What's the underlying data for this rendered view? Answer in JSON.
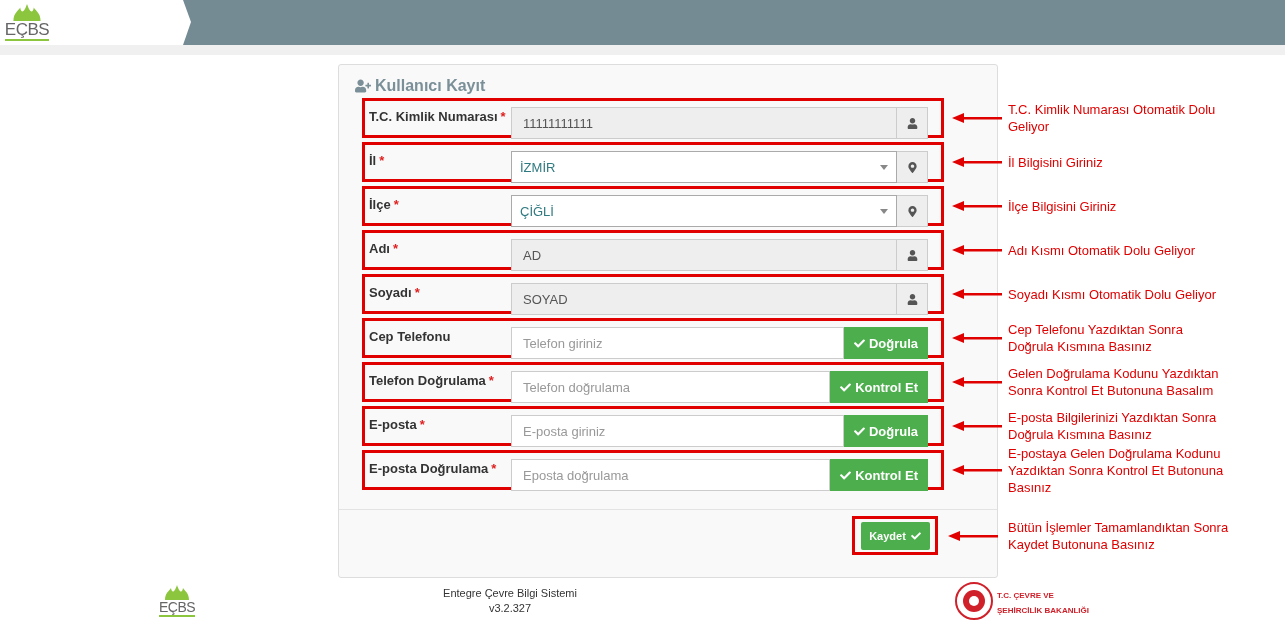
{
  "header": {
    "logo_text": "EÇBS"
  },
  "form": {
    "title": "Kullanıcı Kayıt",
    "fields": [
      {
        "kind": "readonly",
        "label": "T.C. Kimlik Numarası",
        "required_mark": "*",
        "value": "11111111111",
        "highlighted": true,
        "note": "T.C. Kimlik Numarası Otomatik Dolu Geliyor"
      },
      {
        "kind": "select",
        "label": "İl",
        "required_mark": "*",
        "value": "İZMİR",
        "highlighted": true,
        "note": "İl Bilgisini Giriniz"
      },
      {
        "kind": "select",
        "label": "İlçe",
        "required_mark": "*",
        "value": "ÇİĞLİ",
        "highlighted": true,
        "note": "İlçe Bilgisini Giriniz"
      },
      {
        "kind": "readonly",
        "label": "Adı",
        "required_mark": "*",
        "value": "AD",
        "highlighted": true,
        "note": "Adı Kısmı Otomatik Dolu Geliyor"
      },
      {
        "kind": "readonly",
        "label": "Soyadı",
        "required_mark": "*",
        "value": "SOYAD",
        "highlighted": true,
        "note": "Soyadı Kısmı Otomatik Dolu Geliyor"
      },
      {
        "kind": "verify",
        "label": "Cep Telefonu",
        "placeholder": "Telefon giriniz",
        "button": "Doğrula",
        "highlighted": true,
        "note": "Cep Telefonu Yazdıktan Sonra Doğrula Kısmına Basınız"
      },
      {
        "kind": "verify",
        "label": "Telefon Doğrulama",
        "required_mark": "*",
        "placeholder": "Telefon doğrulama",
        "button": "Kontrol Et",
        "highlighted": true,
        "note": "Gelen Doğrulama Kodunu Yazdıktan Sonra Kontrol Et Butonuna Basalım"
      },
      {
        "kind": "verify",
        "label": "E-posta",
        "required_mark": "*",
        "placeholder": "E-posta giriniz",
        "button": "Doğrula",
        "highlighted": true,
        "note": "E-posta Bilgilerinizi Yazdıktan Sonra Doğrula Kısmına Basınız"
      },
      {
        "kind": "verify",
        "label": "E-posta Doğrulama",
        "required_mark": "*",
        "placeholder": "Eposta doğrulama",
        "button": "Kontrol Et",
        "highlighted": true,
        "note": "E-postaya Gelen Doğrulama Kodunu Yazdıktan Sonra Kontrol Et Butonuna Basınız"
      }
    ],
    "save_button": {
      "label": "Kaydet",
      "highlighted": true,
      "note": "Bütün İşlemler Tamamlandıktan Sonra Kaydet Butonuna Basınız"
    }
  },
  "footer": {
    "logo_text": "EÇBS",
    "system_name": "Entegre Çevre Bilgi Sistemi",
    "version": "v3.2.327",
    "ministry_lines": [
      "T.C. ÇEVRE VE",
      "ŞEHİRCİLİK BAKANLIĞI"
    ]
  }
}
